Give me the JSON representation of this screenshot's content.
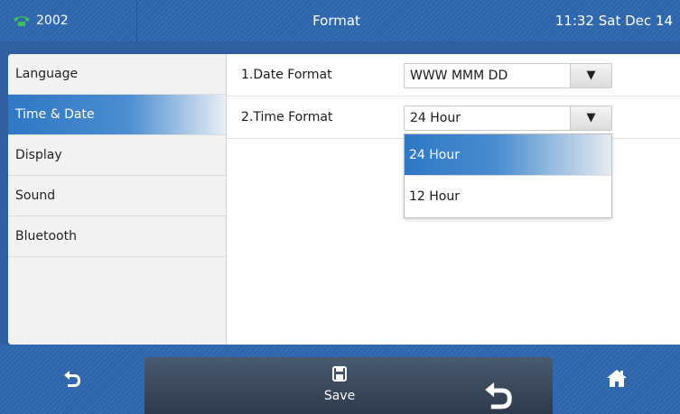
{
  "status_bar": {
    "account": "2002",
    "title": "Format",
    "clock": "11:32 Sat Dec 14",
    "phone_icon": "phone-icon",
    "phone_icon_color": "#3bbf5a"
  },
  "sidebar": {
    "items": [
      {
        "label": "Language",
        "active": false
      },
      {
        "label": "Time & Date",
        "active": true
      },
      {
        "label": "Display",
        "active": false
      },
      {
        "label": "Sound",
        "active": false
      },
      {
        "label": "Bluetooth",
        "active": false
      }
    ]
  },
  "settings": {
    "date_format": {
      "label": "1.Date Format",
      "value": "WWW MMM DD"
    },
    "time_format": {
      "label": "2.Time Format",
      "value": "24 Hour"
    }
  },
  "dropdown": {
    "options": [
      {
        "label": "24 Hour",
        "selected": true
      },
      {
        "label": "12 Hour",
        "selected": false
      }
    ]
  },
  "softkeys": {
    "left_icon": "back-icon",
    "save_label": "Save",
    "save_icon": "save-icon",
    "center_back_icon": "back-icon",
    "right_icon": "home-icon"
  },
  "colors": {
    "accent": "#2f78c4",
    "bar_blue": "#2e66ad"
  }
}
